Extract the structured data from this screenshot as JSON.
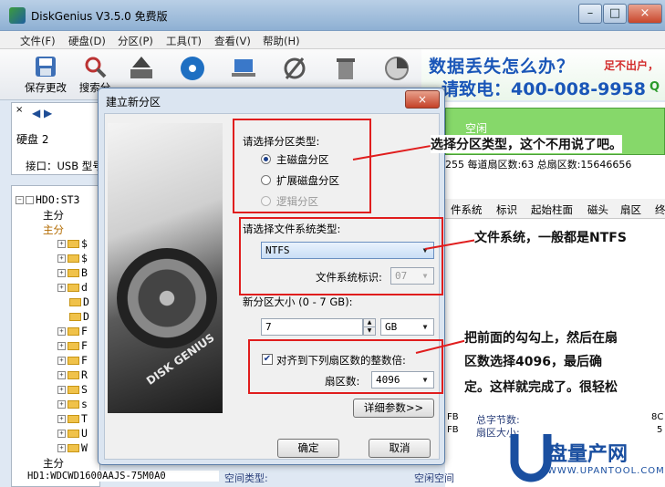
{
  "window": {
    "title": "DiskGenius V3.5.0 免费版",
    "buttons": {
      "minimize": "–",
      "maximize": "□",
      "close": "×"
    }
  },
  "menu": [
    "文件(F)",
    "硬盘(D)",
    "分区(P)",
    "工具(T)",
    "查看(V)",
    "帮助(H)"
  ],
  "toolbar": [
    {
      "label": "保存更改",
      "icon": "save-icon"
    },
    {
      "label": "搜索分",
      "icon": "search-icon"
    }
  ],
  "ad": {
    "line1": "数据丢失怎么办？",
    "line1_right": "足不出户，",
    "line2": "请致电：400-008-9958",
    "line2_right": "Q"
  },
  "left_panel": {
    "disk_label": "硬盘 2",
    "interface_label": "接口：USB  型号"
  },
  "tree": [
    {
      "text": "HDO:ST3",
      "level": 0
    },
    {
      "text": "主分",
      "level": 1
    },
    {
      "text": "主分",
      "level": 1
    },
    {
      "text": "$",
      "level": 2
    },
    {
      "text": "$",
      "level": 2
    },
    {
      "text": "B",
      "level": 2
    },
    {
      "text": "d",
      "level": 2
    },
    {
      "text": "D",
      "level": 2
    },
    {
      "text": "D",
      "level": 2
    },
    {
      "text": "F",
      "level": 2
    },
    {
      "text": "F",
      "level": 2
    },
    {
      "text": "F",
      "level": 2
    },
    {
      "text": "R",
      "level": 2
    },
    {
      "text": "S",
      "level": 2
    },
    {
      "text": "s",
      "level": 2
    },
    {
      "text": "T",
      "level": 2
    },
    {
      "text": "U",
      "level": 2
    },
    {
      "text": "W",
      "level": 2
    },
    {
      "text": "主分",
      "level": 1
    }
  ],
  "bottom_tree_item": "HD1:WDCWD1600AAJS-75M0A0",
  "right_panel": {
    "green_text": "空闲",
    "stats": "255  每道扇区数:63  总扇区数:15646656",
    "headers": [
      "件系统",
      "标识",
      "起始柱面",
      "磁头",
      "扇区",
      "终"
    ],
    "info_rows": [
      "总字节数:",
      "扇区大小:"
    ],
    "right_values": [
      "8C",
      "5"
    ],
    "footer_left": "空间类型:",
    "footer_right": "空闲空间"
  },
  "dialog": {
    "title": "建立新分区",
    "close": "×",
    "image_text": "DISK GENIUS",
    "partition_type": {
      "label": "请选择分区类型:",
      "options": [
        {
          "label": "主磁盘分区",
          "selected": true,
          "enabled": true
        },
        {
          "label": "扩展磁盘分区",
          "selected": false,
          "enabled": true
        },
        {
          "label": "逻辑分区",
          "selected": false,
          "enabled": false
        }
      ]
    },
    "filesystem": {
      "label": "请选择文件系统类型:",
      "value": "NTFS",
      "id_label": "文件系统标识:",
      "id_value": "07"
    },
    "size": {
      "label": "新分区大小 (0 - 7 GB):",
      "value": "7",
      "unit": "GB"
    },
    "align": {
      "checked": true,
      "label": "对齐到下列扇区数的整数倍:",
      "sector_label": "扇区数:",
      "sector_value": "4096"
    },
    "detail_button": "详细参数>>",
    "ok_button": "确定",
    "cancel_button": "取消"
  },
  "annotations": {
    "callout1": "选择分区类型，这个不用说了吧。",
    "callout2": "文件系统，一般都是NTFS",
    "callout3_line1": "把前面的勾勾上，然后在扇",
    "callout3_line2": "区数选择4096，最后确",
    "callout3_line3": "定。这样就完成了。很轻松"
  },
  "watermark": {
    "text": "盘量产网",
    "url": "WWW.UPANTOOL.COM"
  },
  "colors": {
    "annotation_red": "#e01d1d",
    "ad_blue": "#1a56b8",
    "selection_blue": "#1d3f8a"
  }
}
